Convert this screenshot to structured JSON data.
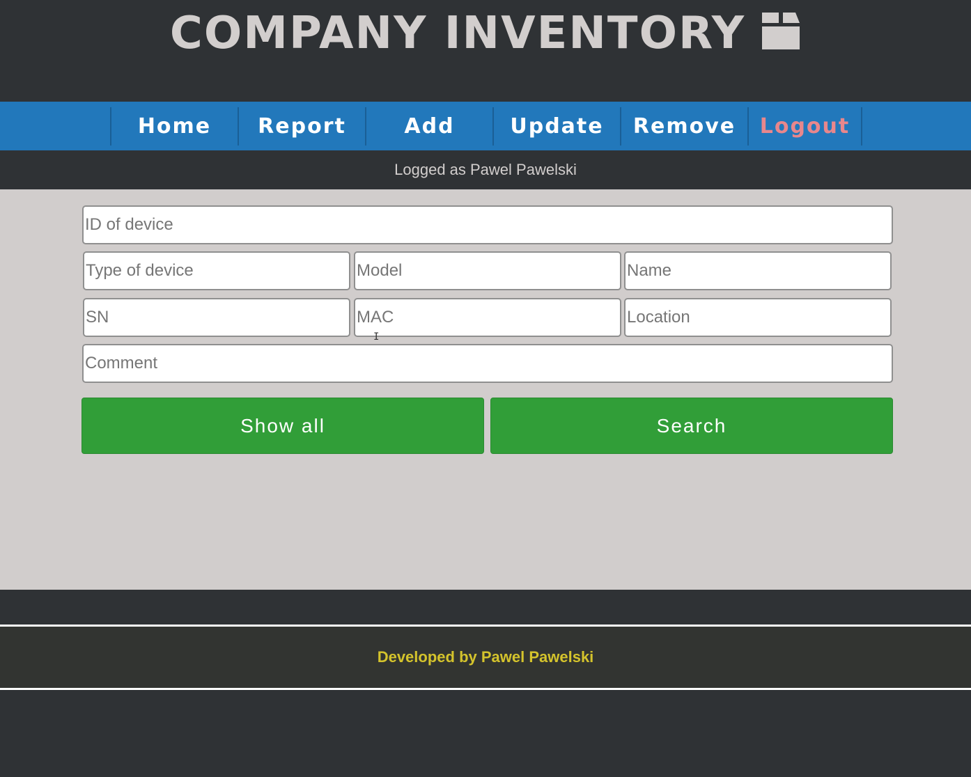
{
  "header": {
    "title": "COMPANY INVENTORY",
    "icon": "box-icon"
  },
  "nav": {
    "items": [
      {
        "label": "Home"
      },
      {
        "label": "Report"
      },
      {
        "label": "Add"
      },
      {
        "label": "Update"
      },
      {
        "label": "Remove"
      },
      {
        "label": "Logout"
      }
    ],
    "logout_color": "#e8878c"
  },
  "status": {
    "logged_text": "Logged as Pawel Pawelski"
  },
  "form": {
    "id_placeholder": "ID of device",
    "type_placeholder": "Type of device",
    "model_placeholder": "Model",
    "name_placeholder": "Name",
    "sn_placeholder": "SN",
    "mac_placeholder": "MAC",
    "location_placeholder": "Location",
    "comment_placeholder": "Comment",
    "show_all_label": "Show all",
    "search_label": "Search"
  },
  "footer": {
    "text": "Developed by Pawel Pawelski"
  },
  "colors": {
    "nav": "#2278bb",
    "button": "#319e38",
    "footer_text": "#d4c32c"
  }
}
